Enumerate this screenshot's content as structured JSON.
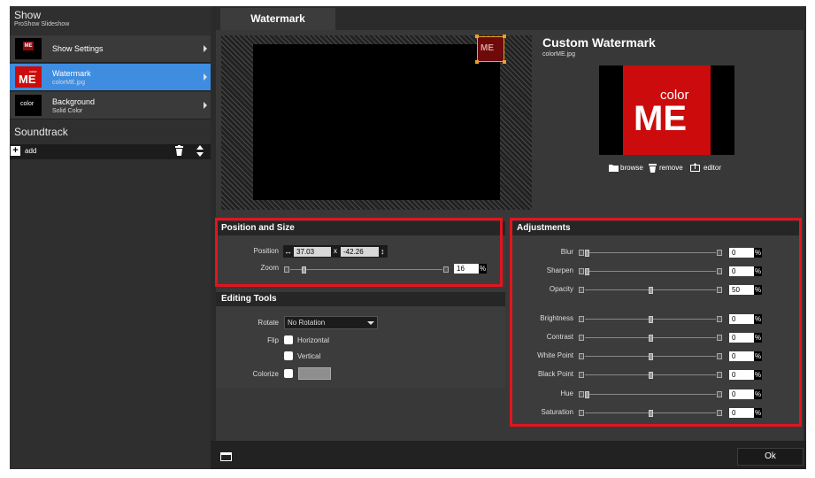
{
  "sidebar": {
    "show_title": "Show",
    "show_subtitle": "ProShow Slideshow",
    "items": [
      {
        "label": "Show Settings",
        "sub": "",
        "thumb_text": "ME"
      },
      {
        "label": "Watermark",
        "sub": "colorME.jpg",
        "thumb_text": "ME",
        "thumb_text_small": "color"
      },
      {
        "label": "Background",
        "sub": "Solid Color",
        "thumb_text": "color"
      }
    ],
    "soundtrack_title": "Soundtrack",
    "add_label": "add"
  },
  "tab": {
    "label": "Watermark"
  },
  "preview": {
    "watermark_text": "ME"
  },
  "watermark_info": {
    "title": "Custom Watermark",
    "filename": "colorME.jpg",
    "logo_small": "color",
    "logo_big": "ME",
    "browse_label": "browse",
    "remove_label": "remove",
    "editor_label": "editor"
  },
  "position_size": {
    "title": "Position and Size",
    "position_label": "Position",
    "pos_x": "37.03",
    "x_sep": "x",
    "pos_y": "-42.26",
    "zoom_label": "Zoom",
    "zoom_value": "16",
    "zoom_fraction": 0.08,
    "pct": "%"
  },
  "editing_tools": {
    "title": "Editing Tools",
    "rotate_label": "Rotate",
    "rotate_value": "No Rotation",
    "flip_label": "Flip",
    "horizontal_label": "Horizontal",
    "vertical_label": "Vertical",
    "colorize_label": "Colorize"
  },
  "adjustments": {
    "title": "Adjustments",
    "pct": "%",
    "rows": [
      {
        "label": "Blur",
        "value": "0",
        "fraction": 0.0
      },
      {
        "label": "Sharpen",
        "value": "0",
        "fraction": 0.0
      },
      {
        "label": "Opacity",
        "value": "50",
        "fraction": 0.5
      },
      {
        "label": "Brightness",
        "value": "0",
        "fraction": 0.5
      },
      {
        "label": "Contrast",
        "value": "0",
        "fraction": 0.5
      },
      {
        "label": "White Point",
        "value": "0",
        "fraction": 0.5
      },
      {
        "label": "Black Point",
        "value": "0",
        "fraction": 0.5
      },
      {
        "label": "Hue",
        "value": "0",
        "fraction": 0.0
      },
      {
        "label": "Saturation",
        "value": "0",
        "fraction": 0.5
      }
    ]
  },
  "footer": {
    "ok_label": "Ok"
  },
  "colors": {
    "accent": "#3e8de0",
    "highlight": "#e2151f",
    "logo_red": "#cc0c0c"
  }
}
